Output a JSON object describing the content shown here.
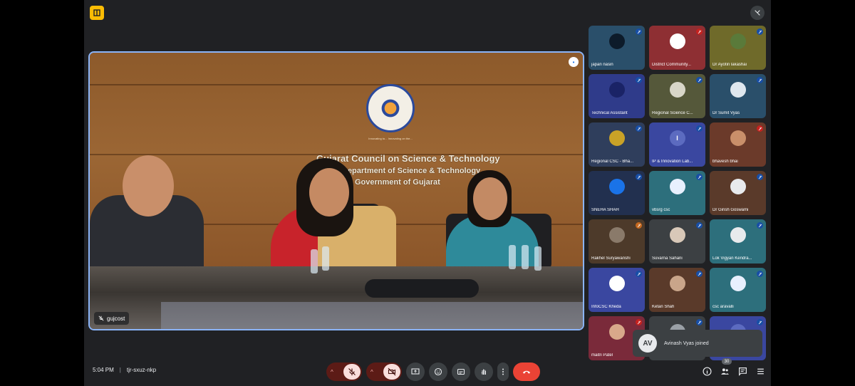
{
  "meeting": {
    "time": "5:04 PM",
    "separator": "|",
    "code": "tjr-sxuz-nkp"
  },
  "presenter": {
    "name": "gujcost",
    "wall_text": {
      "line1": "Gujarat Council on Science & Technology",
      "line2": "Department of Science & Technology",
      "line3": "Government of Gujarat"
    },
    "logo_text": "Innovating to... Innovating on the..."
  },
  "participants": [
    {
      "name": "japan nasin",
      "bg": "#2a4f6a",
      "avatar_bg": "#0d1b2a",
      "avatar": "",
      "mic_bg": "#174ea6"
    },
    {
      "name": "District Community...",
      "bg": "#8e2f33",
      "avatar_bg": "#ffffff",
      "avatar": "",
      "mic_bg": "#c5221f"
    },
    {
      "name": "Dr Ayotin lakashai",
      "bg": "#6f6a2a",
      "avatar_bg": "#5a7a3a",
      "avatar": "",
      "mic_bg": "#174ea6"
    },
    {
      "name": "Technical Assistant",
      "bg": "#2f3b8a",
      "avatar_bg": "#1a2366",
      "avatar": "",
      "mic_bg": "#174ea6"
    },
    {
      "name": "Regional Science C...",
      "bg": "#55583a",
      "avatar_bg": "#d8d6c8",
      "avatar": "",
      "mic_bg": "#174ea6"
    },
    {
      "name": "Dr Sumit Vyas",
      "bg": "#2a4f6a",
      "avatar_bg": "#dfe7ee",
      "avatar": "",
      "mic_bg": "#174ea6"
    },
    {
      "name": "Regional CSC - Bha...",
      "bg": "#2f3e5c",
      "avatar_bg": "#c9a227",
      "avatar": "",
      "mic_bg": "#174ea6"
    },
    {
      "name": "IP & Innovation Lab...",
      "bg": "#3a47a0",
      "avatar_bg": "#5c6bc0",
      "avatar": "I",
      "mic_bg": "#174ea6"
    },
    {
      "name": "bhavesh bhai",
      "bg": "#6b3a2a",
      "avatar_bg": "#c98f6a",
      "avatar": "",
      "mic_bg": "#c5221f"
    },
    {
      "name": "SNEHA SHAH",
      "bg": "#22304f",
      "avatar_bg": "#1a73e8",
      "avatar": "",
      "mic_bg": "#174ea6"
    },
    {
      "name": "vbsrg csc",
      "bg": "#2d6f7c",
      "avatar_bg": "#e8f0fe",
      "avatar": "",
      "mic_bg": "#174ea6"
    },
    {
      "name": "Dr Girish Goswami",
      "bg": "#5a3a2a",
      "avatar_bg": "#e8eaed",
      "avatar": "",
      "mic_bg": "#174ea6"
    },
    {
      "name": "Rakhel Suryawanshi",
      "bg": "#4d3a2a",
      "avatar_bg": "#8a7a6a",
      "avatar": "",
      "mic_bg": "#c5681f"
    },
    {
      "name": "Suvarna Sahani",
      "bg": "#3c4043",
      "avatar_bg": "#d8c8b8",
      "avatar": "",
      "mic_bg": "#174ea6"
    },
    {
      "name": "Lok Vigyan Kendra...",
      "bg": "#2d6f7c",
      "avatar_bg": "#e8eaed",
      "avatar": "",
      "mic_bg": "#174ea6"
    },
    {
      "name": "InfoCSC Kheda",
      "bg": "#3a47a0",
      "avatar_bg": "#ffffff",
      "avatar": "",
      "mic_bg": "#174ea6"
    },
    {
      "name": "Ketan Shah",
      "bg": "#5a3a2a",
      "avatar_bg": "#c9a58a",
      "avatar": "",
      "mic_bg": "#174ea6"
    },
    {
      "name": "csc aravalli",
      "bg": "#2d6f7c",
      "avatar_bg": "#e8f0fe",
      "avatar": "",
      "mic_bg": "#174ea6"
    },
    {
      "name": "maitri Patel",
      "bg": "#7a2a3a",
      "avatar_bg": "#d8a88a",
      "avatar": "",
      "mic_bg": "#c5221f"
    },
    {
      "name": "",
      "bg": "#3c4043",
      "avatar_bg": "#9aa0a6",
      "avatar": "",
      "mic_bg": "#174ea6"
    },
    {
      "name": "",
      "bg": "#3a47a0",
      "avatar_bg": "#5c6bc0",
      "avatar": "",
      "mic_bg": "#174ea6"
    }
  ],
  "toast": {
    "text": "Avinash Vyas joined",
    "avatar": "AV"
  },
  "toolbar": {
    "participant_count": "30"
  },
  "colors": {
    "accent": "#8ab4f8",
    "leave": "#ea4335",
    "muted_bg": "#f9dedc"
  }
}
